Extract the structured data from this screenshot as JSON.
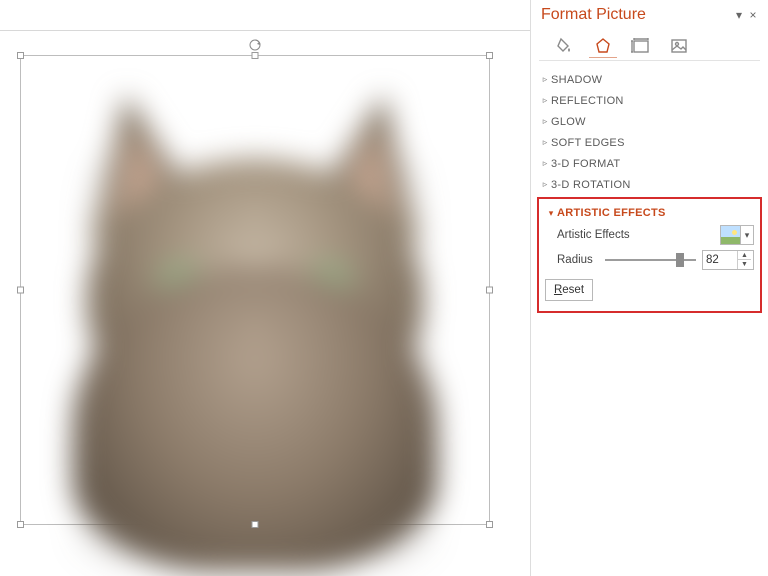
{
  "panel": {
    "title": "Format Picture",
    "dropdown_glyph": "▾",
    "close_glyph": "×",
    "tabs": [
      {
        "name": "fill-line",
        "active": false
      },
      {
        "name": "effects",
        "active": true
      },
      {
        "name": "size-properties",
        "active": false
      },
      {
        "name": "picture",
        "active": false
      }
    ],
    "sections": [
      {
        "label": "SHADOW",
        "open": false
      },
      {
        "label": "REFLECTION",
        "open": false
      },
      {
        "label": "GLOW",
        "open": false
      },
      {
        "label": "SOFT EDGES",
        "open": false
      },
      {
        "label": "3-D FORMAT",
        "open": false
      },
      {
        "label": "3-D ROTATION",
        "open": false
      },
      {
        "label": "ARTISTIC EFFECTS",
        "open": true
      }
    ],
    "artistic": {
      "row_label": "Artistic Effects",
      "radius_label": "Radius",
      "radius_value": "82",
      "radius_percent": 82,
      "reset_label": "Reset",
      "reset_underline_char": "R"
    }
  },
  "canvas": {
    "selected_object": "cat-picture"
  }
}
